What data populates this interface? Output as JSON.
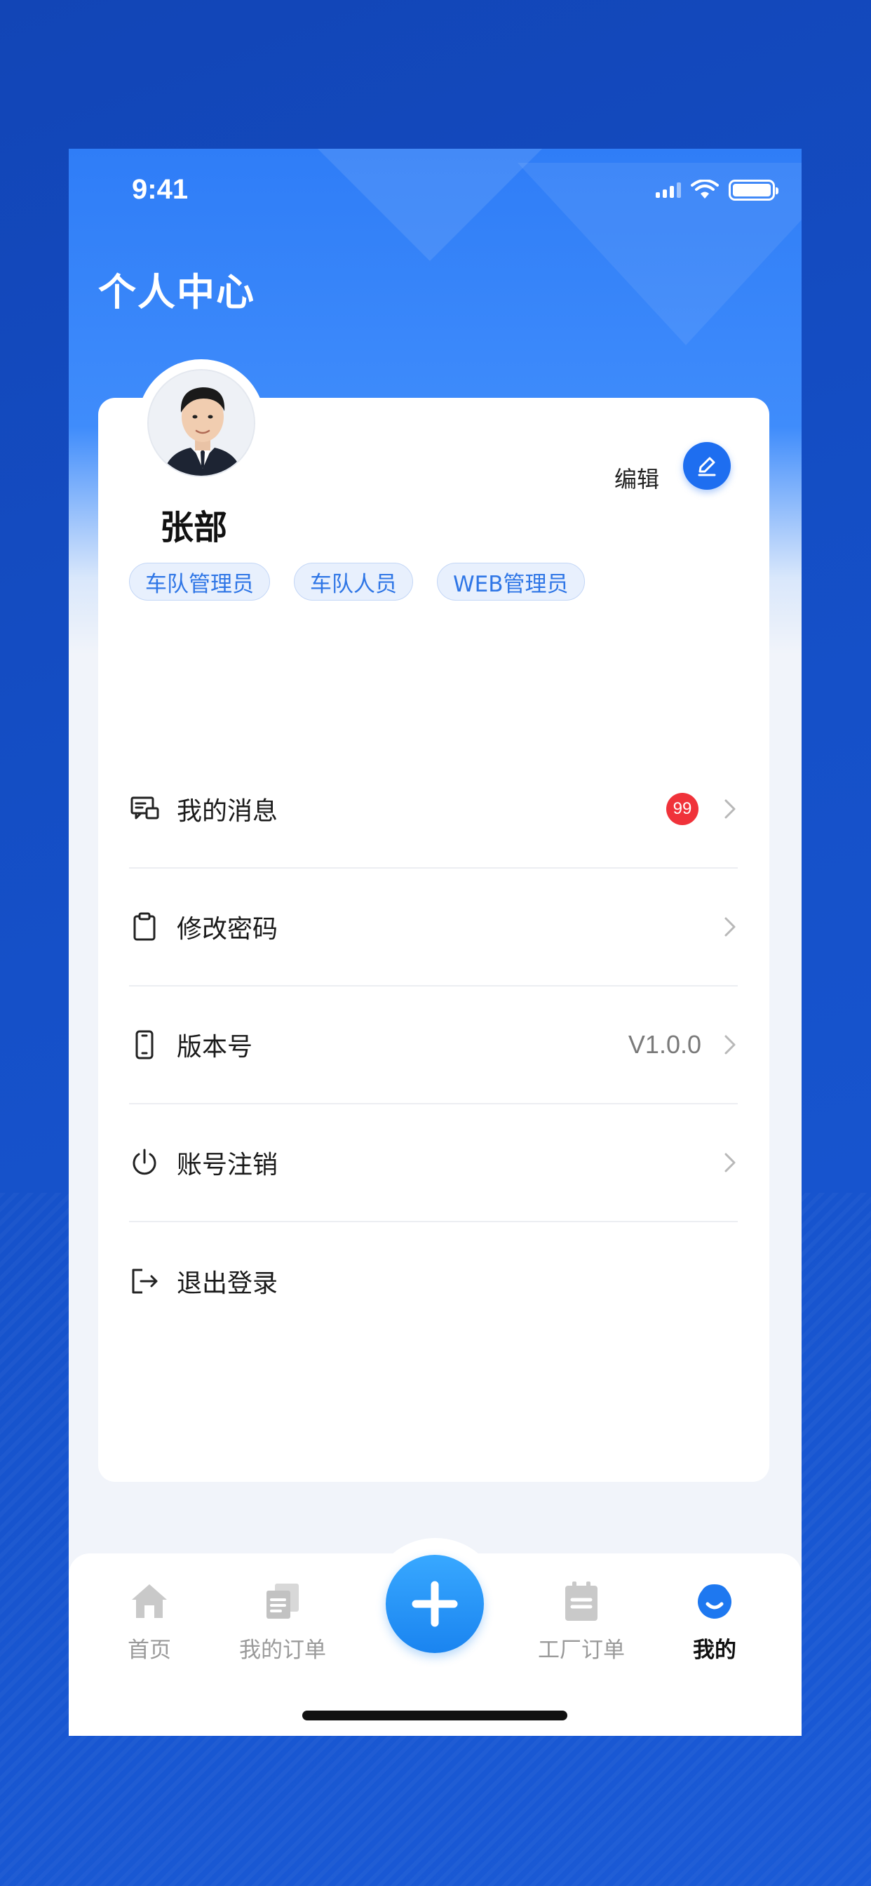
{
  "status_bar": {
    "time": "9:41"
  },
  "header": {
    "title": "个人中心"
  },
  "profile": {
    "name": "张部",
    "edit_label": "编辑",
    "roles": [
      "车队管理员",
      "车队人员",
      "WEB管理员"
    ]
  },
  "menu": [
    {
      "label": "我的消息",
      "badge": "99",
      "value": "",
      "icon": "message-icon"
    },
    {
      "label": "修改密码",
      "badge": "",
      "value": "",
      "icon": "clipboard-icon"
    },
    {
      "label": "版本号",
      "badge": "",
      "value": "V1.0.0",
      "icon": "phone-icon"
    },
    {
      "label": "账号注销",
      "badge": "",
      "value": "",
      "icon": "power-icon"
    },
    {
      "label": "退出登录",
      "badge": "",
      "value": "",
      "icon": "logout-icon"
    }
  ],
  "tabbar": {
    "items": [
      {
        "label": "首页",
        "icon": "home-icon"
      },
      {
        "label": "我的订单",
        "icon": "orders-icon"
      },
      {
        "label": "",
        "icon": "add-icon"
      },
      {
        "label": "工厂订单",
        "icon": "factory-order-icon"
      },
      {
        "label": "我的",
        "icon": "profile-icon",
        "active": true
      }
    ]
  },
  "colors": {
    "primary": "#1e6ef0",
    "background": "#1550c8",
    "badge": "#f0323a"
  }
}
